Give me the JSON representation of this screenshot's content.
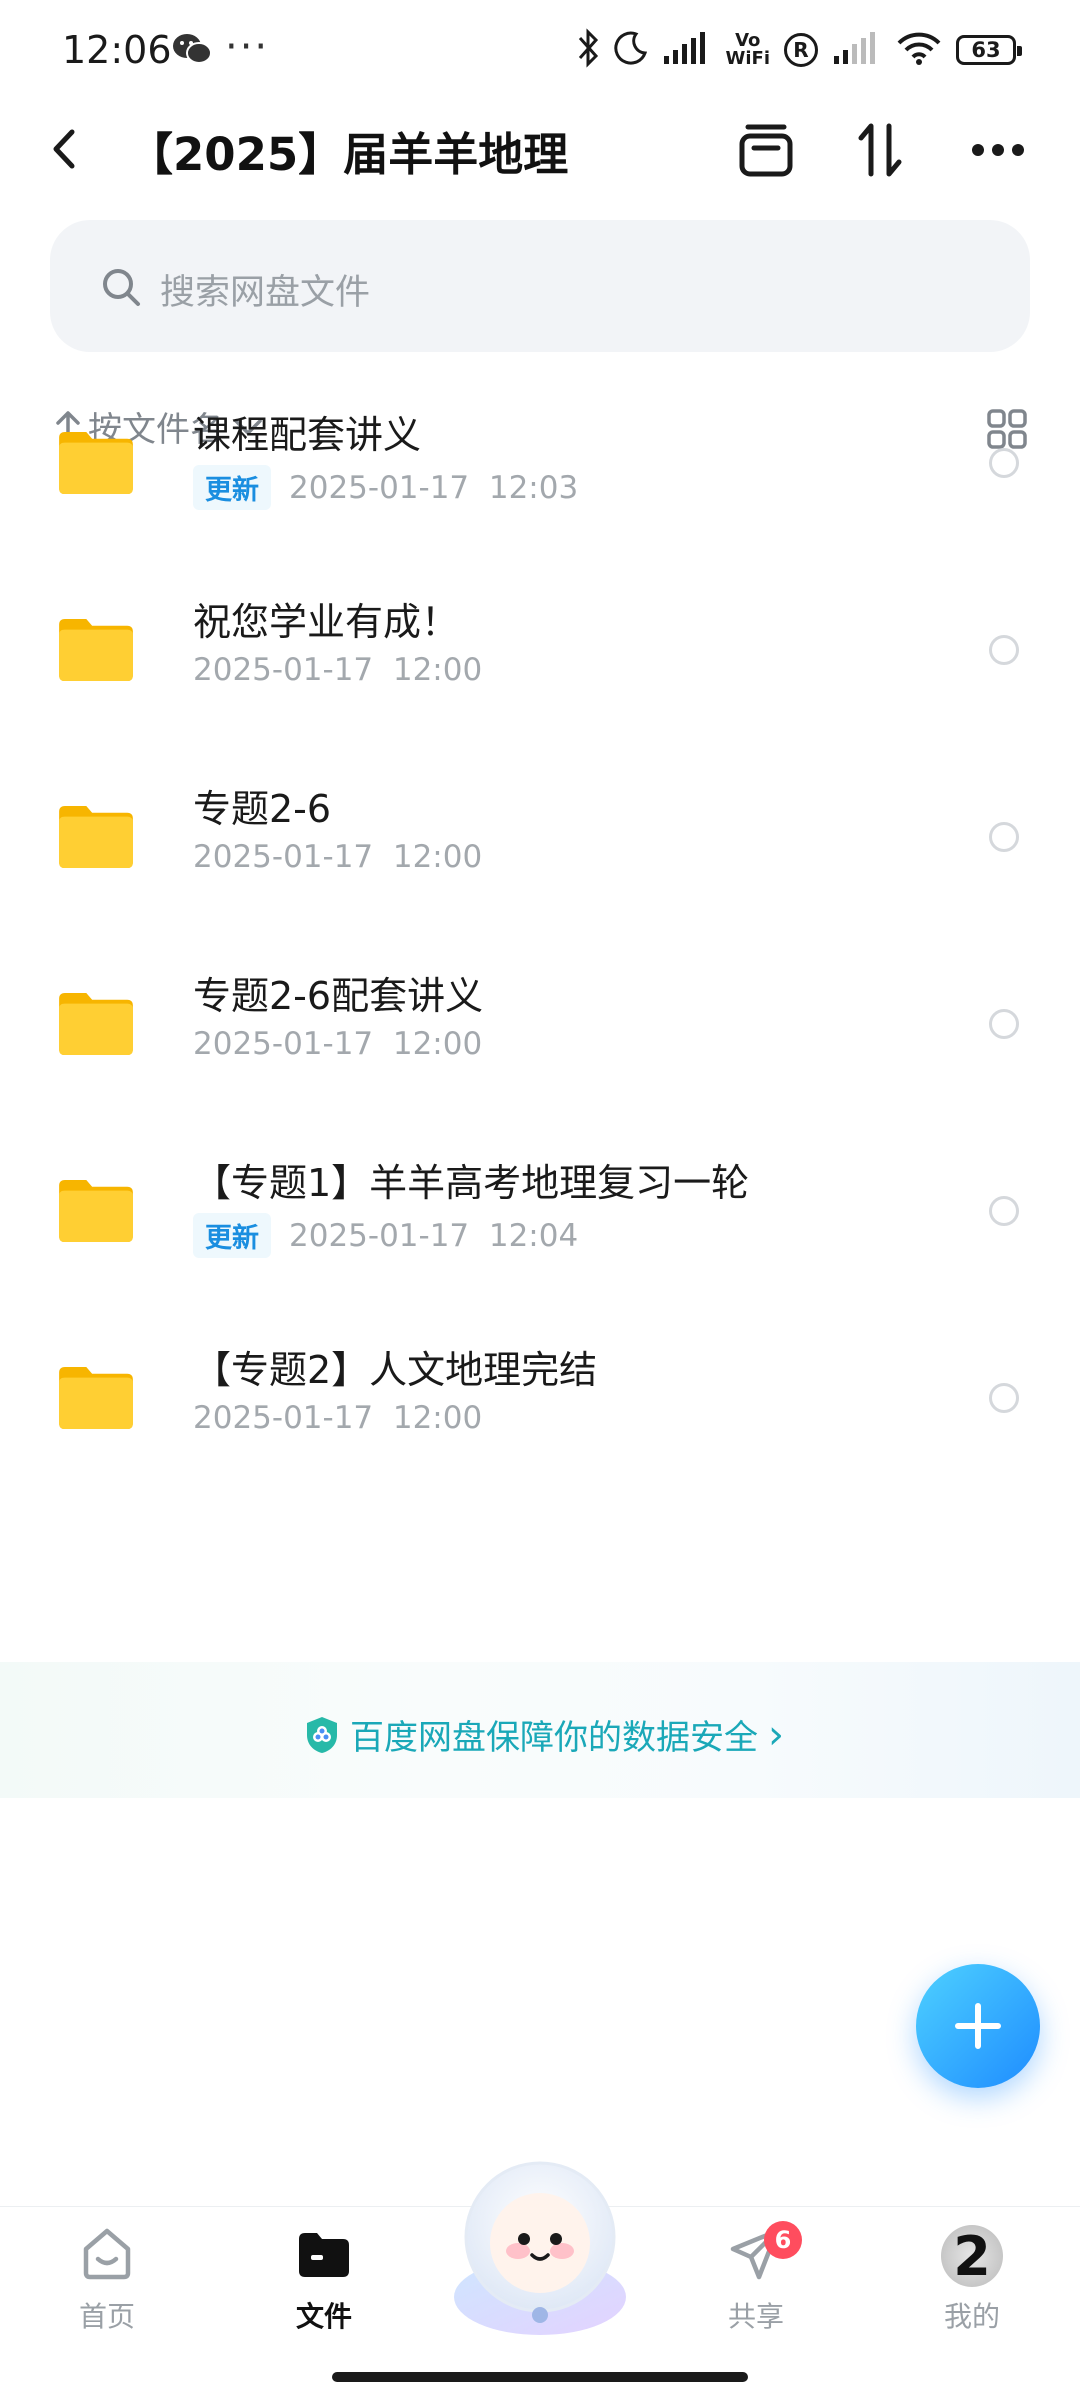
{
  "status_bar": {
    "time": "12:06",
    "more": "···",
    "vo": "Vo",
    "wifi_label": "WiFi",
    "registered": "R",
    "battery": "63"
  },
  "header": {
    "title": "【2025】届羊羊地理"
  },
  "search": {
    "placeholder": "搜索网盘文件"
  },
  "sort": {
    "label": "按文件名"
  },
  "files": [
    {
      "name": "课程配套讲义",
      "badge": "更新",
      "date": "2025-01-17  12:03"
    },
    {
      "name": "祝您学业有成！",
      "badge": "",
      "date": "2025-01-17  12:00"
    },
    {
      "name": "专题2-6",
      "badge": "",
      "date": "2025-01-17  12:00"
    },
    {
      "name": "专题2-6配套讲义",
      "badge": "",
      "date": "2025-01-17  12:00"
    },
    {
      "name": "【专题1】羊羊高考地理复习一轮",
      "badge": "更新",
      "date": "2025-01-17  12:04"
    },
    {
      "name": "【专题2】人文地理完结",
      "badge": "",
      "date": "2025-01-17  12:00"
    }
  ],
  "banner": {
    "text": "百度网盘保障你的数据安全",
    "arrow": "›"
  },
  "nav": {
    "items": [
      {
        "label": "首页",
        "icon": "home-icon"
      },
      {
        "label": "文件",
        "icon": "folder-icon"
      },
      {
        "label": "",
        "icon": "mascot-icon"
      },
      {
        "label": "共享",
        "icon": "paper-plane-icon",
        "badge": "6"
      },
      {
        "label": "我的",
        "icon": "avatar-icon",
        "avatar_text": "2"
      }
    ]
  },
  "colors": {
    "accent": "#1e8cff",
    "folder": "#ffcf33",
    "badge_text": "#1a8ee0",
    "banner_text": "#1aa8b8",
    "nav_badge": "#ff4d5e"
  }
}
